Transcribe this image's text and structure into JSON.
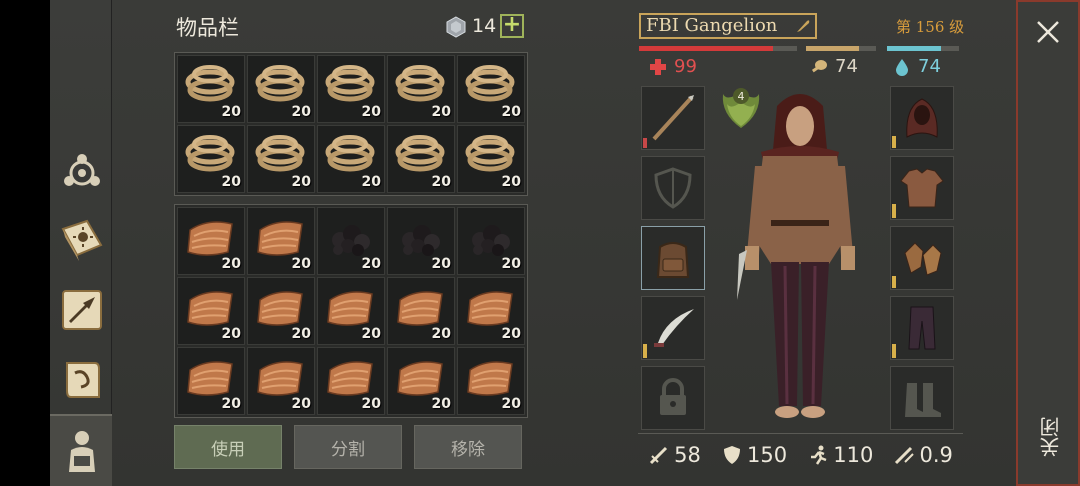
{
  "inventory": {
    "title": "物品栏",
    "gem_count": "14",
    "plus_label": "+",
    "rope_rows": [
      [
        "20",
        "20",
        "20",
        "20",
        "20"
      ],
      [
        "20",
        "20",
        "20",
        "20",
        "20"
      ]
    ],
    "bottom_rows": [
      [
        {
          "item": "leather",
          "qty": "20"
        },
        {
          "item": "leather",
          "qty": "20"
        },
        {
          "item": "coal",
          "qty": "20"
        },
        {
          "item": "coal",
          "qty": "20"
        },
        {
          "item": "coal",
          "qty": "20"
        }
      ],
      [
        {
          "item": "leather",
          "qty": "20"
        },
        {
          "item": "leather",
          "qty": "20"
        },
        {
          "item": "leather",
          "qty": "20"
        },
        {
          "item": "leather",
          "qty": "20"
        },
        {
          "item": "leather",
          "qty": "20"
        }
      ],
      [
        {
          "item": "leather",
          "qty": "20"
        },
        {
          "item": "leather",
          "qty": "20"
        },
        {
          "item": "leather",
          "qty": "20"
        },
        {
          "item": "leather",
          "qty": "20"
        },
        {
          "item": "leather",
          "qty": "20"
        }
      ]
    ],
    "buttons": {
      "use": "使用",
      "split": "分割",
      "remove": "移除"
    }
  },
  "character": {
    "name": "FBI Gangelion",
    "level": "第 156 级",
    "badge_level": "4",
    "hp": "99",
    "hunger": "74",
    "water": "74",
    "hp_fill": 0.85,
    "hunger_fill": 0.75,
    "water_fill": 0.75,
    "attack": "58",
    "defense": "150",
    "speed": "110",
    "crit": "0.9"
  },
  "close": {
    "label": "关闭"
  },
  "colors": {
    "accent_gold": "#c9a45a",
    "hp": "#d33a3a",
    "water": "#6cc4d0",
    "close_border": "#8a3a2c"
  }
}
